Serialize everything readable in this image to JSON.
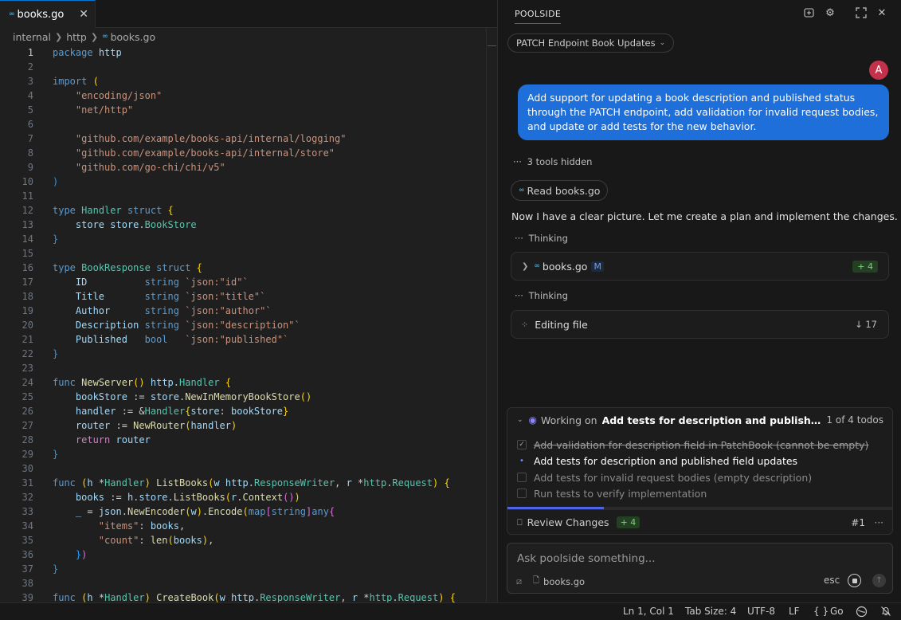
{
  "editor": {
    "tab_label": "books.go",
    "breadcrumb": [
      "internal",
      "http",
      "books.go"
    ],
    "lines": [
      "package http",
      "",
      "import (",
      "    \"encoding/json\"",
      "    \"net/http\"",
      "",
      "    \"github.com/example/books-api/internal/logging\"",
      "    \"github.com/example/books-api/internal/store\"",
      "    \"github.com/go-chi/chi/v5\"",
      ")",
      "",
      "type Handler struct {",
      "    store store.BookStore",
      "}",
      "",
      "type BookResponse struct {",
      "    ID          string `json:\"id\"`",
      "    Title       string `json:\"title\"`",
      "    Author      string `json:\"author\"`",
      "    Description string `json:\"description\"`",
      "    Published   bool   `json:\"published\"`",
      "}",
      "",
      "func NewServer() http.Handler {",
      "    bookStore := store.NewInMemoryBookStore()",
      "    handler := &Handler{store: bookStore}",
      "    router := NewRouter(handler)",
      "    return router",
      "}",
      "",
      "func (h *Handler) ListBooks(w http.ResponseWriter, r *http.Request) {",
      "    books := h.store.ListBooks(r.Context())",
      "    _ = json.NewEncoder(w).Encode(map[string]any{",
      "        \"items\": books,",
      "        \"count\": len(books),",
      "    })",
      "}",
      "",
      "func (h *Handler) CreateBook(w http.ResponseWriter, r *http.Request) {"
    ]
  },
  "panel": {
    "title": "POOLSIDE",
    "session": "PATCH Endpoint Book Updates",
    "avatar_letter": "A",
    "user_message": "Add support for updating a book description and published status through the PATCH endpoint, add validation for invalid request bodies, and update or add tests for the new behavior.",
    "tools_hidden": "3 tools hidden",
    "read_chip": "Read books.go",
    "assistant_text": "Now I have a clear picture. Let me create a plan and implement the changes.",
    "thinking_1": "Thinking",
    "file_card": {
      "name": "books.go",
      "badge": "M",
      "added": "+ 4"
    },
    "thinking_2": "Thinking",
    "editing_card": {
      "label": "Editing file",
      "count": "↓ 17"
    },
    "todo": {
      "label": "Working on",
      "task": "Add tests for description and published field updates",
      "count": "1 of 4 todos",
      "progress": 0.25,
      "items": [
        {
          "text": "Add validation for description field in PatchBook (cannot be empty)",
          "state": "done"
        },
        {
          "text": "Add tests for description and published field updates",
          "state": "active"
        },
        {
          "text": "Add tests for invalid request bodies (empty description)",
          "state": "pending"
        },
        {
          "text": "Run tests to verify implementation",
          "state": "pending"
        }
      ],
      "review_label": "Review Changes",
      "review_added": "+ 4",
      "ref": "#1"
    },
    "input": {
      "placeholder": "Ask poolside something...",
      "file_chip": "books.go",
      "esc_label": "esc"
    }
  },
  "statusbar": {
    "position": "Ln 1, Col 1",
    "tab_size": "Tab Size: 4",
    "encoding": "UTF-8",
    "eol": "LF",
    "language": "Go",
    "braces": "{ }"
  },
  "colors": {
    "accent": "#0078d4",
    "user_bubble": "#1e6fd9",
    "avatar": "#c4314b",
    "progress": "#4f63e8"
  }
}
